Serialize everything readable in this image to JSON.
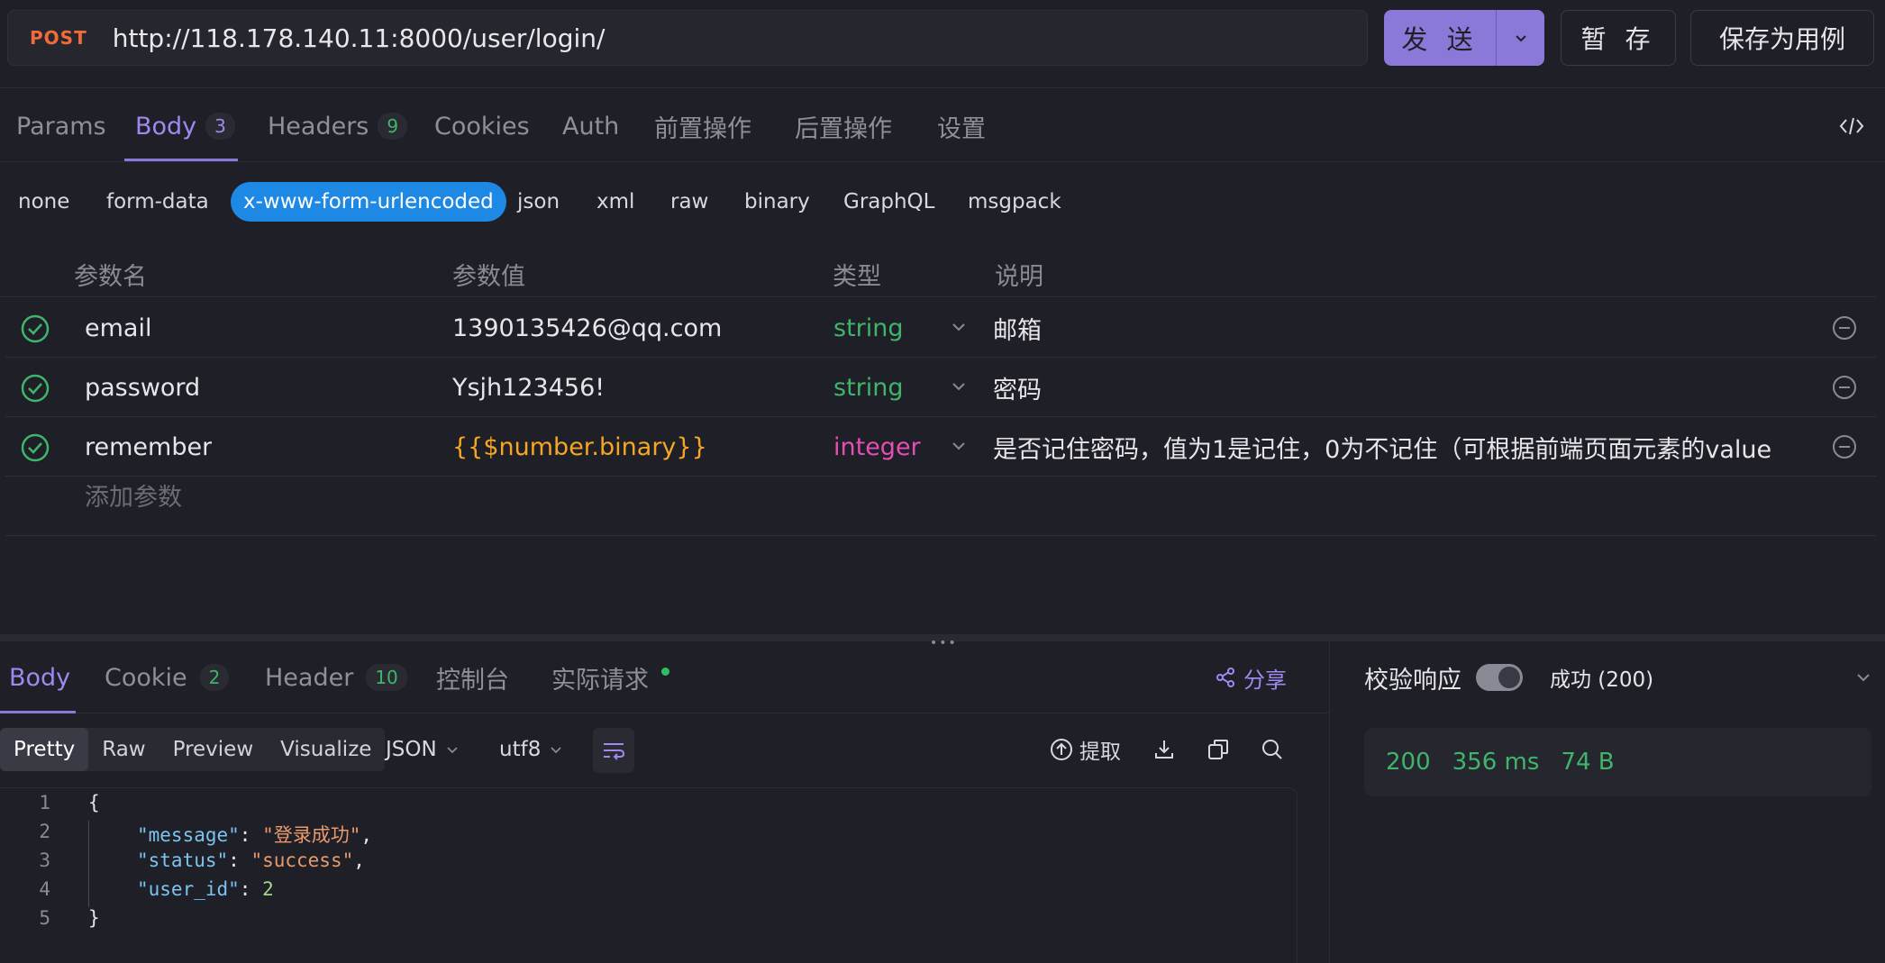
{
  "request": {
    "method": "POST",
    "url": "http://118.178.140.11:8000/user/login/",
    "send_label": "发 送",
    "save_label": "暂 存",
    "save_case_label": "保存为用例"
  },
  "req_tabs": [
    {
      "label": "Params"
    },
    {
      "label": "Body",
      "count": "3"
    },
    {
      "label": "Headers",
      "count": "9"
    },
    {
      "label": "Cookies"
    },
    {
      "label": "Auth"
    },
    {
      "label": "前置操作"
    },
    {
      "label": "后置操作"
    },
    {
      "label": "设置"
    }
  ],
  "body_types": [
    "none",
    "form-data",
    "x-www-form-urlencoded",
    "json",
    "xml",
    "raw",
    "binary",
    "GraphQL",
    "msgpack"
  ],
  "params": {
    "headers": [
      "参数名",
      "参数值",
      "类型",
      "说明"
    ],
    "rows": [
      {
        "name": "email",
        "value": "1390135426@qq.com",
        "type": "string",
        "desc": "邮箱"
      },
      {
        "name": "password",
        "value": "Ysjh123456!",
        "type": "string",
        "desc": "密码"
      },
      {
        "name": "remember",
        "value": "{{$number.binary}}",
        "type": "integer",
        "desc": "是否记住密码，值为1是记住，0为不记住（可根据前端页面元素的value"
      }
    ],
    "add_placeholder": "添加参数"
  },
  "response": {
    "tabs": [
      {
        "label": "Body"
      },
      {
        "label": "Cookie",
        "count": "2"
      },
      {
        "label": "Header",
        "count": "10"
      },
      {
        "label": "控制台"
      },
      {
        "label": "实际请求"
      }
    ],
    "share_label": "分享",
    "views": [
      "Pretty",
      "Raw",
      "Preview",
      "Visualize"
    ],
    "format": "JSON",
    "encoding": "utf8",
    "extract_label": "提取",
    "code": {
      "line_numbers": [
        "1",
        "2",
        "3",
        "4",
        "5"
      ],
      "open": "{",
      "close": "}",
      "entries": [
        {
          "key": "\"message\"",
          "value": "\"登录成功\"",
          "sep": ","
        },
        {
          "key": "\"status\"",
          "value": "\"success\"",
          "sep": ","
        },
        {
          "key": "\"user_id\"",
          "value": "2",
          "sep": ""
        }
      ]
    }
  },
  "validation": {
    "label": "校验响应",
    "status": "成功 (200)",
    "status_code": "200",
    "time": "356 ms",
    "size": "74 B"
  },
  "colors": {
    "accent": "#8c78d8",
    "active_chip": "#1e88e5",
    "success": "#3fb56b",
    "method": "#f06a3a"
  }
}
